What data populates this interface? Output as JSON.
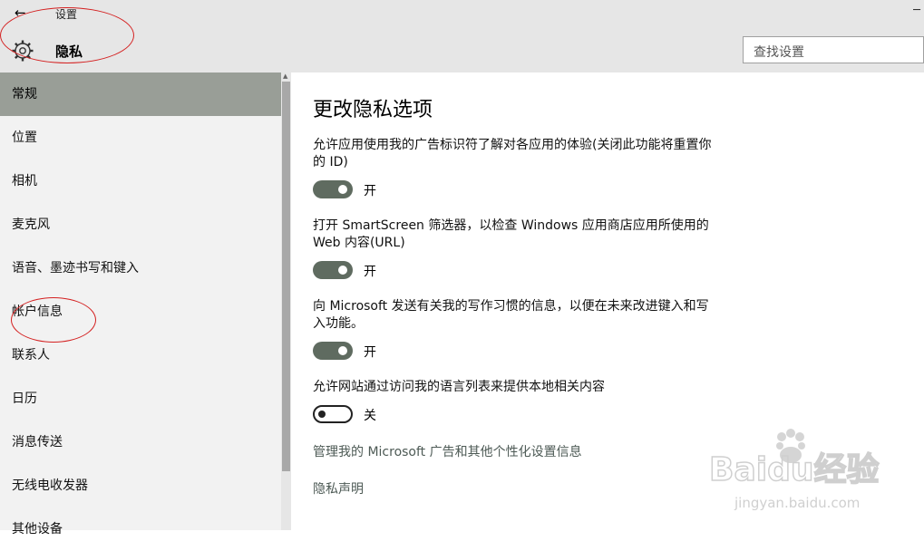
{
  "titlebar": {
    "back_glyph": "←",
    "app_title": "设置",
    "minimize_glyph": "─",
    "page_heading": "隐私",
    "gear_icon": "gear-icon",
    "search_placeholder": "查找设置"
  },
  "sidebar": {
    "items": [
      {
        "label": "常规",
        "selected": true
      },
      {
        "label": "位置"
      },
      {
        "label": "相机"
      },
      {
        "label": "麦克风"
      },
      {
        "label": "语音、墨迹书写和键入"
      },
      {
        "label": "帐户信息"
      },
      {
        "label": "联系人"
      },
      {
        "label": "日历"
      },
      {
        "label": "消息传送"
      },
      {
        "label": "无线电收发器"
      },
      {
        "label": "其他设备"
      }
    ]
  },
  "main": {
    "title": "更改隐私选项",
    "settings": [
      {
        "desc": "允许应用使用我的广告标识符了解对各应用的体验(关闭此功能将重置你的 ID)",
        "state": "开"
      },
      {
        "desc": "打开 SmartScreen 筛选器，以检查 Windows 应用商店应用所使用的 Web 内容(URL)",
        "state": "开"
      },
      {
        "desc": "向 Microsoft 发送有关我的写作习惯的信息，以便在未来改进键入和写入功能。",
        "state": "开"
      },
      {
        "desc": "允许网站通过访问我的语言列表来提供本地相关内容",
        "state": "关"
      }
    ],
    "link_manage": "管理我的 Microsoft 广告和其他个性化设置信息",
    "link_privacy": "隐私声明"
  },
  "colors": {
    "accent": "#5f6b60",
    "selected_nav": "#999e97",
    "annotation": "#d42020"
  },
  "watermark": {
    "text_main": "Baidu经验",
    "text_url": "jingyan.baidu.com"
  }
}
